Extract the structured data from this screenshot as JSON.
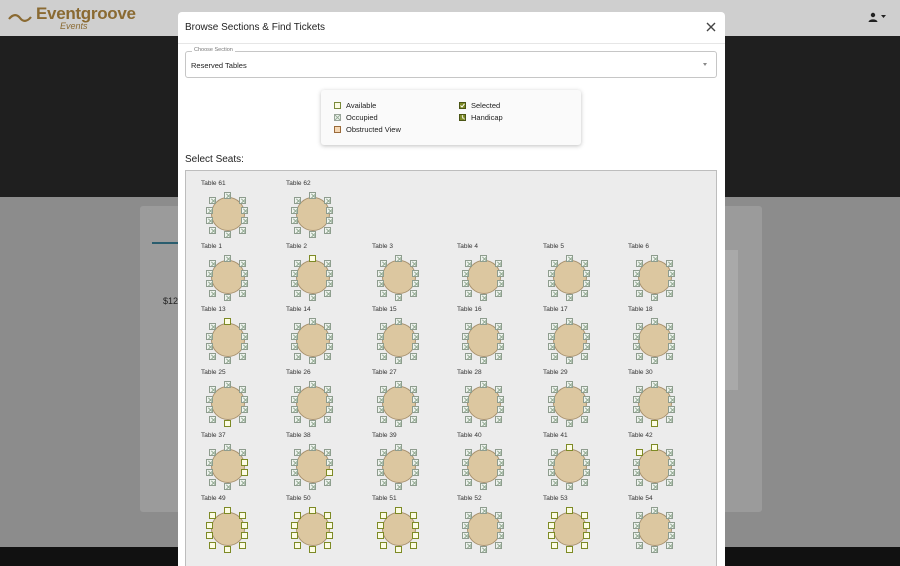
{
  "site": {
    "brand_name": "Eventgroove",
    "brand_sub": "Events",
    "price_fragment": "$12",
    "brand_color": "#8a6a32"
  },
  "modal": {
    "title": "Browse Sections & Find Tickets",
    "section_label": "Choose Section",
    "section_value": "Reserved Tables"
  },
  "legend": {
    "available": "Available",
    "occupied": "Occupied",
    "obstructed": "Obstructed View",
    "selected": "Selected",
    "handicap": "Handicap"
  },
  "select_seats_label": "Select Seats:",
  "tables": [
    {
      "label": "Table 61",
      "available": []
    },
    {
      "label": "Table 62",
      "available": []
    },
    {
      "label": "Table 1",
      "available": []
    },
    {
      "label": "Table 2",
      "available": [
        0
      ]
    },
    {
      "label": "Table 3",
      "available": []
    },
    {
      "label": "Table 4",
      "available": []
    },
    {
      "label": "Table 5",
      "available": []
    },
    {
      "label": "Table 6",
      "available": []
    },
    {
      "label": "Table 13",
      "available": [
        0
      ]
    },
    {
      "label": "Table 14",
      "available": []
    },
    {
      "label": "Table 15",
      "available": []
    },
    {
      "label": "Table 16",
      "available": []
    },
    {
      "label": "Table 17",
      "available": []
    },
    {
      "label": "Table 18",
      "available": []
    },
    {
      "label": "Table 25",
      "available": [
        5
      ]
    },
    {
      "label": "Table 26",
      "available": []
    },
    {
      "label": "Table 27",
      "available": []
    },
    {
      "label": "Table 28",
      "available": []
    },
    {
      "label": "Table 29",
      "available": []
    },
    {
      "label": "Table 30",
      "available": [
        5
      ]
    },
    {
      "label": "Table 37",
      "available": [
        2,
        3
      ]
    },
    {
      "label": "Table 38",
      "available": [
        3
      ]
    },
    {
      "label": "Table 39",
      "available": []
    },
    {
      "label": "Table 40",
      "available": []
    },
    {
      "label": "Table 41",
      "available": [
        0
      ]
    },
    {
      "label": "Table 42",
      "available": [
        0,
        9
      ]
    },
    {
      "label": "Table 49",
      "available": [
        0,
        1,
        2,
        3,
        4,
        5,
        6,
        7,
        8,
        9
      ]
    },
    {
      "label": "Table 50",
      "available": [
        0,
        1,
        2,
        3,
        4,
        5,
        6,
        7,
        8,
        9
      ]
    },
    {
      "label": "Table 51",
      "available": [
        0,
        1,
        2,
        3,
        4,
        5,
        6,
        7,
        8,
        9
      ]
    },
    {
      "label": "Table 52",
      "available": []
    },
    {
      "label": "Table 53",
      "available": [
        0,
        1,
        2,
        3,
        4,
        5,
        6,
        7,
        8,
        9
      ]
    },
    {
      "label": "Table 54",
      "available": []
    }
  ]
}
